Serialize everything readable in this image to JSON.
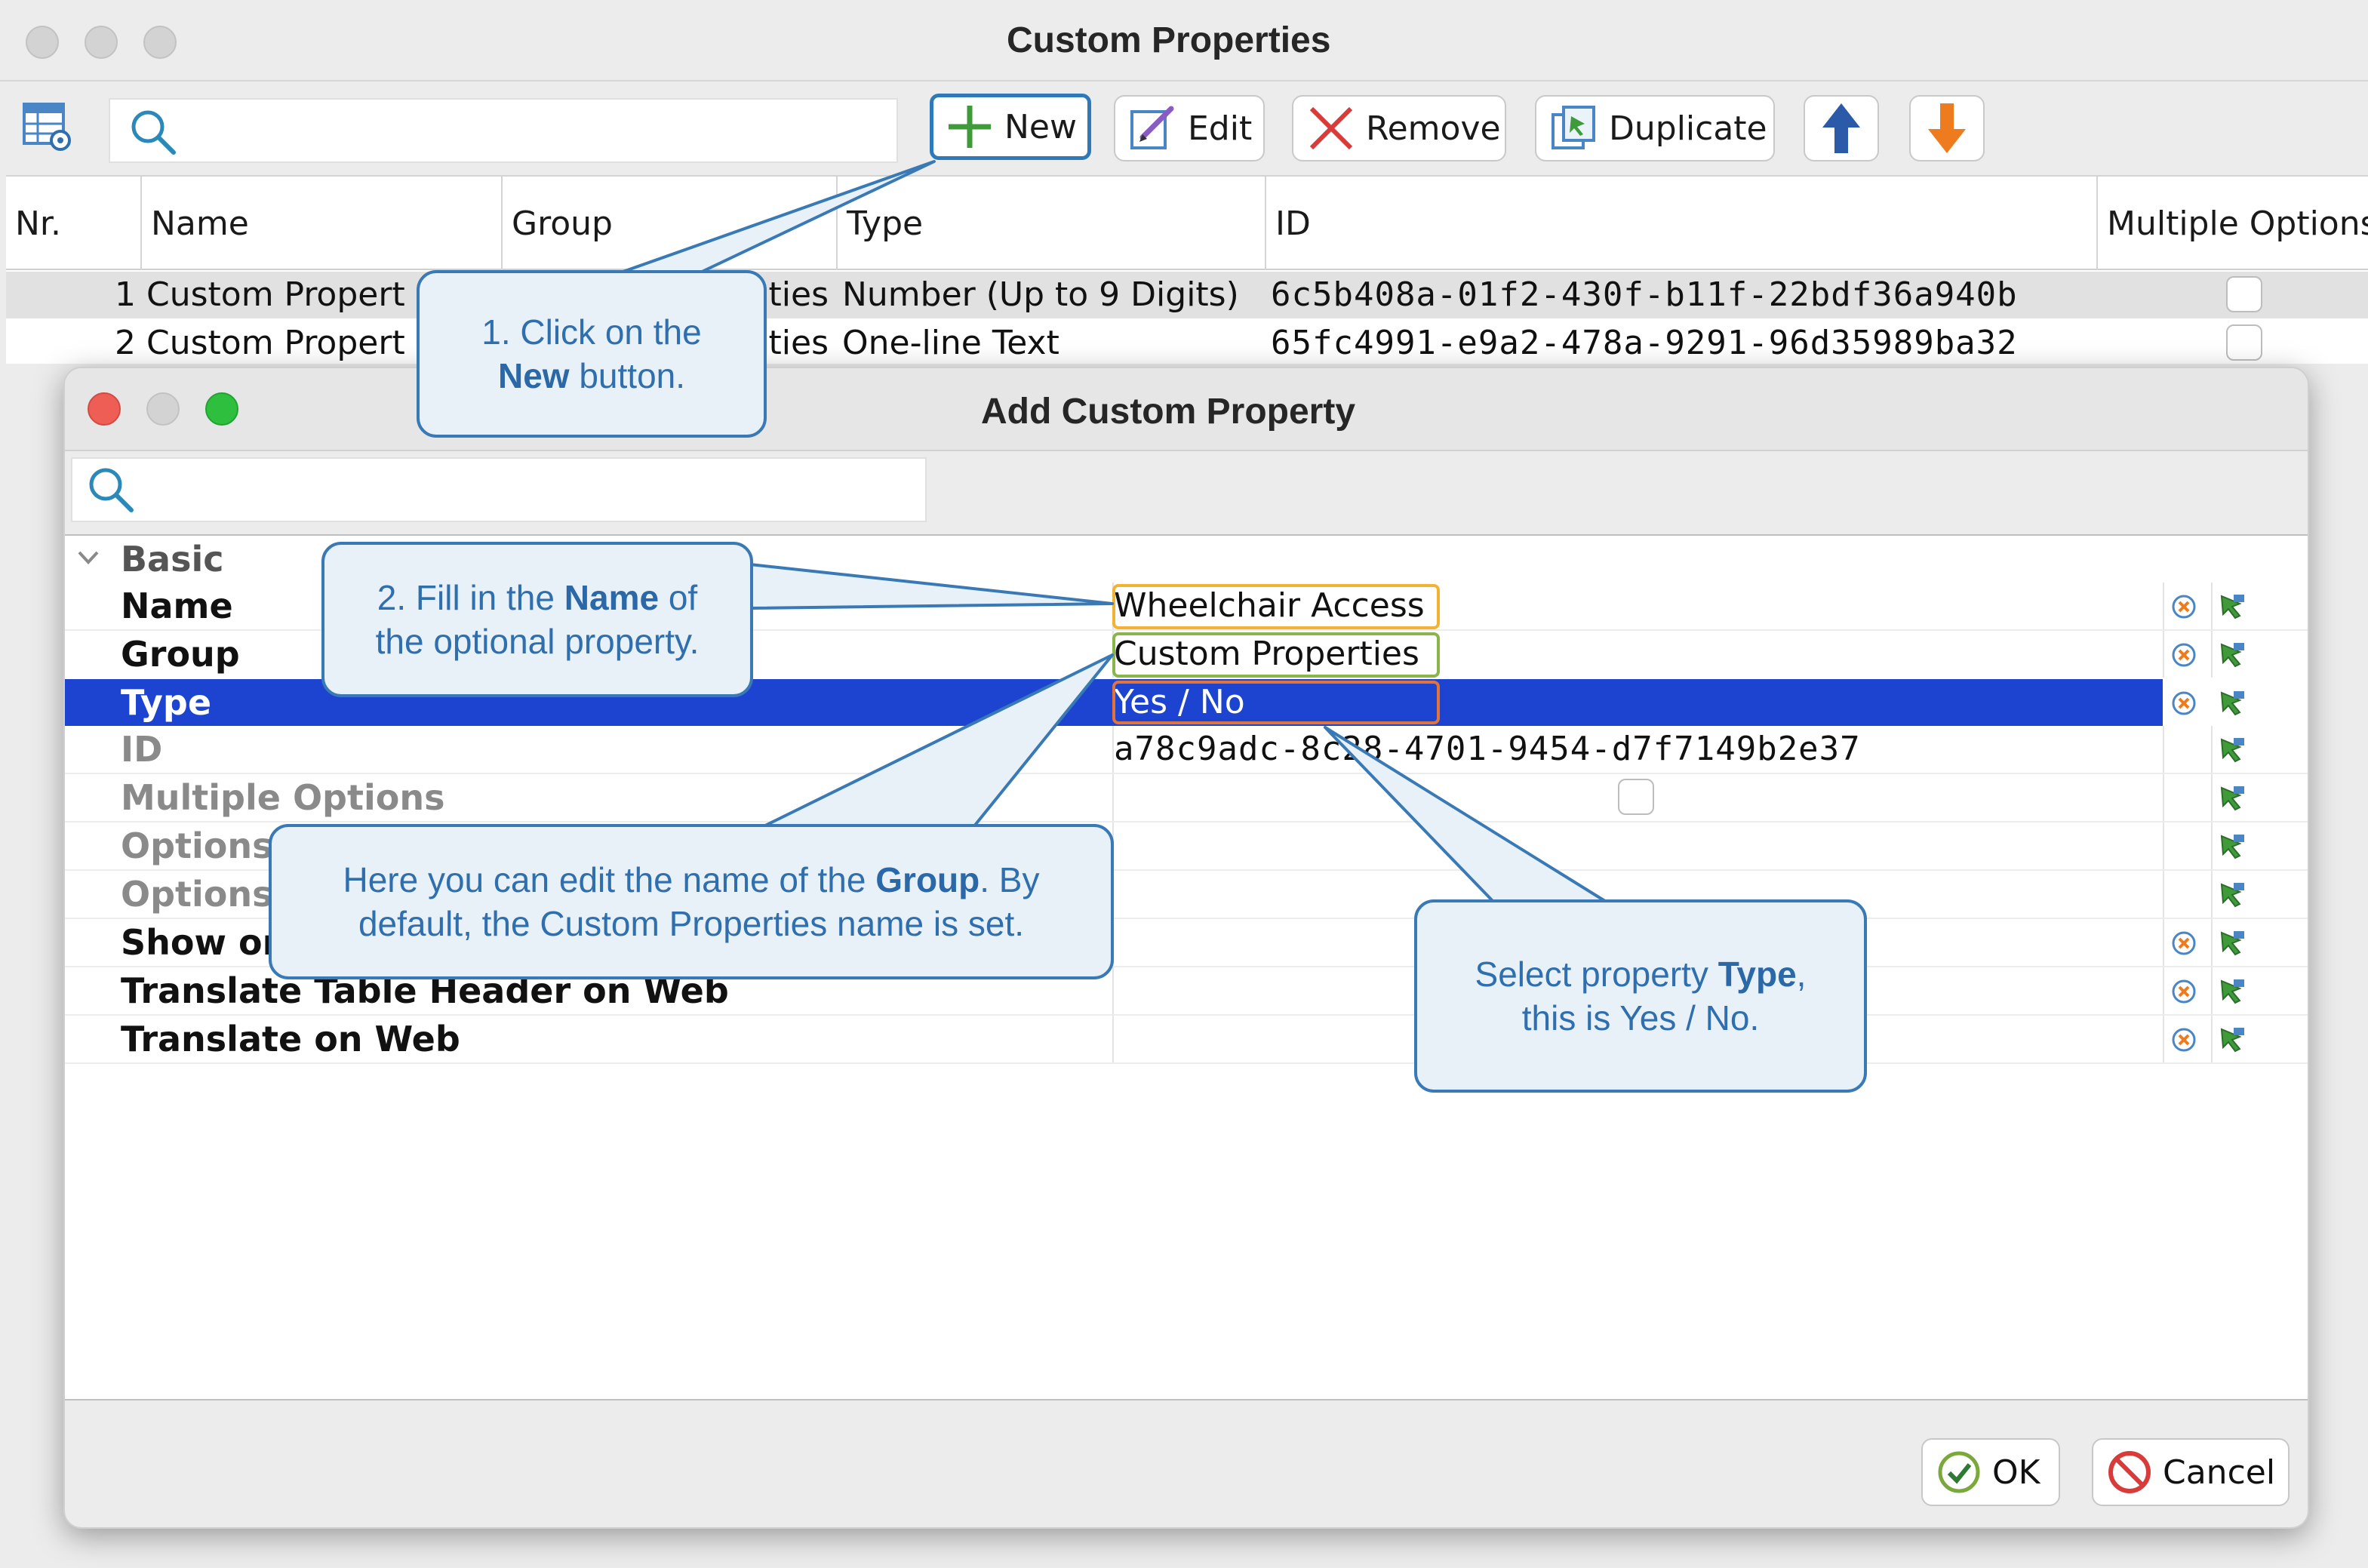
{
  "main_window": {
    "title": "Custom Properties",
    "toolbar": {
      "search_placeholder": "",
      "new_label": "New",
      "edit_label": "Edit",
      "remove_label": "Remove",
      "duplicate_label": "Duplicate"
    },
    "table": {
      "columns": [
        "Nr.",
        "Name",
        "Group",
        "Type",
        "ID",
        "Multiple Options"
      ],
      "rows": [
        {
          "nr": "1",
          "name": "Custom Propert",
          "group": "ties",
          "type": "Number (Up to 9 Digits)",
          "id": "6c5b408a-01f2-430f-b11f-22bdf36a940b",
          "multiple": false
        },
        {
          "nr": "2",
          "name": "Custom Propert",
          "group": "ties",
          "type": "One-line Text",
          "id": "65fc4991-e9a2-478a-9291-96d35989ba32",
          "multiple": false
        }
      ]
    }
  },
  "dialog": {
    "title": "Add Custom Property",
    "search_placeholder": "",
    "group_label": "Basic",
    "properties": [
      {
        "name": "Name",
        "value": "Wheelchair Access"
      },
      {
        "name": "Group",
        "value": "Custom Properties"
      },
      {
        "name": "Type",
        "value": "Yes / No"
      },
      {
        "name": "ID",
        "value": "a78c9adc-8c28-4701-9454-d7f7149b2e37"
      },
      {
        "name": "Multiple Options",
        "value": ""
      },
      {
        "name": "Options",
        "value": ""
      },
      {
        "name": "Options",
        "value": ""
      },
      {
        "name": "Show or",
        "value": ""
      },
      {
        "name": "Translate Table Header on Web",
        "value": ""
      },
      {
        "name": "Translate on Web",
        "value": ""
      }
    ],
    "ok_label": "OK",
    "cancel_label": "Cancel"
  },
  "callouts": {
    "step1_a": "1. Click on the",
    "step1_b": "New",
    "step1_c": " button.",
    "step2_a": "2. Fill in the ",
    "step2_b": "Name",
    "step2_c": " of",
    "step2_d": "the optional property.",
    "group_a": "Here you can edit the name of the ",
    "group_b": "Group",
    "group_c": ". By",
    "group_d": "default, the Custom Properties name is set.",
    "type_a": "Select property ",
    "type_b": "Type",
    "type_c": ",",
    "type_d": "this is Yes / No."
  },
  "colors": {
    "selection": "#1c44d0",
    "callout_border": "#3879b6",
    "callout_fill": "#e8f0f8",
    "name_highlight": "#f2b233",
    "group_highlight": "#8ab54a",
    "type_highlight": "#e0743a"
  }
}
